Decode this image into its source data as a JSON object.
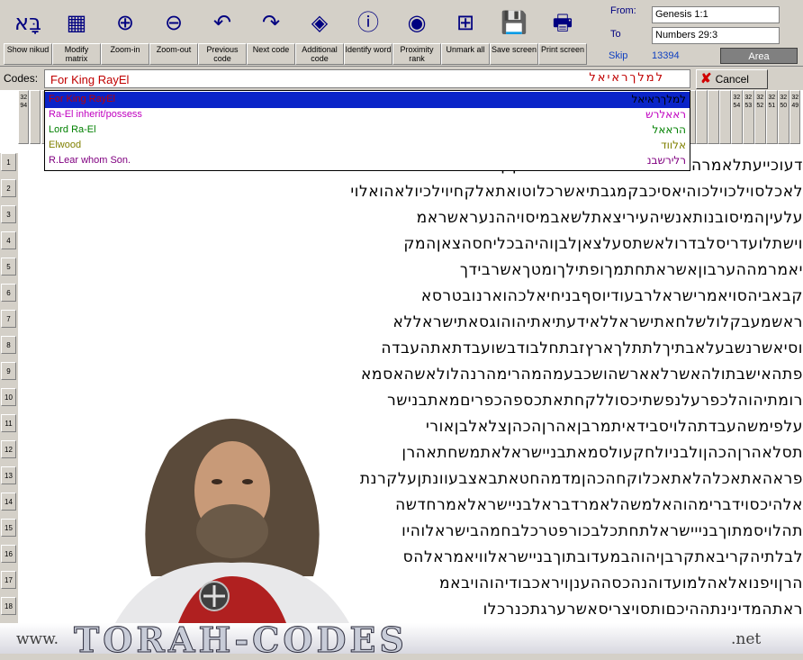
{
  "toolbar": {
    "buttons": [
      {
        "label": "Show nikud",
        "icon": "nikud-icon"
      },
      {
        "label": "Modify matrix",
        "icon": "matrix-icon"
      },
      {
        "label": "Zoom-in",
        "icon": "zoom-in-icon"
      },
      {
        "label": "Zoom-out",
        "icon": "zoom-out-icon"
      },
      {
        "label": "Previous code",
        "icon": "previous-code-icon"
      },
      {
        "label": "Next code",
        "icon": "next-code-icon"
      },
      {
        "label": "Additional code",
        "icon": "additional-code-icon"
      },
      {
        "label": "Identify word",
        "icon": "identify-word-icon"
      },
      {
        "label": "Proximity rank",
        "icon": "proximity-rank-icon"
      },
      {
        "label": "Unmark all",
        "icon": "unmark-all-icon"
      },
      {
        "label": "Save screen",
        "icon": "save-screen-icon"
      },
      {
        "label": "Print screen",
        "icon": "print-screen-icon"
      }
    ],
    "nikud_glyph": "בָּא",
    "range": {
      "from_label": "From:",
      "from_value": "Genesis 1:1",
      "to_label": "To",
      "to_value": "Numbers 29:3"
    },
    "skip_label": "Skip",
    "skip_value": "13394",
    "area_label": "Area"
  },
  "codes": {
    "label": "Codes:",
    "value": "For King RayEl",
    "hebrew_mark": "למלךראיאל",
    "cancel_label": "Cancel"
  },
  "dropdown": [
    {
      "text": "For King RayEl",
      "color": "#c00000",
      "hebrew": "למלךראיאל"
    },
    {
      "text": "Ra-El inherit/possess",
      "color": "#c000c0",
      "hebrew": "ראאלרש"
    },
    {
      "text": "Lord Ra-El",
      "color": "#008000",
      "hebrew": "הראאל"
    },
    {
      "text": "Elwood",
      "color": "#808000",
      "hebrew": "אלווד"
    },
    {
      "text": "R.Lear whom Son.",
      "color": "#800080",
      "hebrew": "רלירשבנ"
    }
  ],
  "column_headers": [
    "3294",
    "",
    "",
    "",
    "",
    "",
    "",
    "",
    "",
    "",
    "",
    "",
    "",
    "",
    "",
    "",
    "",
    "",
    "",
    "",
    "",
    "",
    "",
    "",
    "",
    "",
    "",
    "",
    "",
    "",
    "",
    "",
    "",
    "",
    "",
    "",
    "",
    "",
    "",
    "",
    "",
    "",
    "",
    "",
    "",
    "",
    "",
    "",
    "",
    "",
    "",
    "",
    "",
    "",
    "",
    "",
    "",
    "",
    "",
    "",
    "",
    "3254",
    "3253",
    "3252",
    "3251",
    "3250",
    "3249"
  ],
  "row_numbers": [
    "1",
    "2",
    "3",
    "4",
    "5",
    "6",
    "7",
    "8",
    "9",
    "10",
    "11",
    "12",
    "13",
    "14",
    "15",
    "16",
    "17",
    "18"
  ],
  "matrix_rows": [
    "דעוכייעתלאמרהישיחינורתהשבתוכבנילצדקק",
    "לאכלסוילכוילכוהיאסיכבקמגבתיאשרכלוטואתאלקחיוילכיולאהואלוי",
    "עלעיןהמיסובנותאנשיהעיריצאתלשאבמיסויההנעראשראמ",
    "וישתלועדריסלבדרולאשתסעלצאןלבןוהיהבכליחסהצאןהמק",
    "יאמרמההערבוןאשראתחתמךופתילךומטךאשרבידך",
    "קבאביהסויאמרישראלרבעודיוסףבניחיאלכהוארנובטרסא",
    "ראשמעבקלולשלחאתישראללאידעתיאתיהוהוגסאתישראללא",
    "וסיאשרנשבעלאבתיךלתתלךארץזבתחלבודבשועבדתאתהעבדה",
    "פתהאישבתולהאשרלאארשהושכבעמהמהרימהרנהלולאשהאסמא",
    "רומתיהוהלכפרעלנפשתיכסוללקחתאתכספהכפריםמאתבנישר",
    "עלפימשהעבדתהלויסבידאיתמרבןאהרןהכהןצלאלבןאורי",
    "תסלאהרןהכהןולבניולחקעולסמאתבניישראלאתמשחתאהרן",
    "פראהאתאכלהלאתאכלוקחהכהןמדמהחטאתבאצבעוונתןעלקרנת",
    "אלהיכסוידברימהוהאלמשהלאמרדבראלבניישראלאמרחדשה",
    "תהלויסמתוךבנייישראלתחתכלבכורפטרכלבחמהבישראלוהיו",
    "לבלתיהקריבאתקרבןיהוהבמעדובתוךבניישראלוויאמראלהס",
    "הרןויפנואלאהלמועדוהנהכסההענןויראכבודיהוהויבאמ",
    "ראתהמדינינתההיכםותסויצריסאשרערגתכנרכלו"
  ],
  "footer": {
    "www": "www.",
    "title": "TORAH-CODES",
    "net": ".net"
  }
}
